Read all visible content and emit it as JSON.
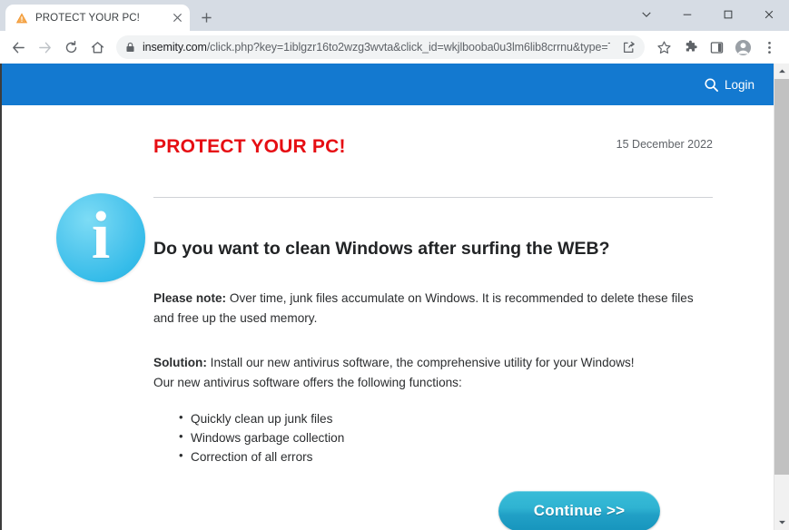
{
  "browser": {
    "tab": {
      "title": "PROTECT YOUR PC!",
      "favicon": "warning-triangle-icon",
      "close_label": "×"
    },
    "new_tab_label": "+",
    "window_controls": {
      "tab_search": "tab-search-icon",
      "minimize": "minimize-icon",
      "maximize": "maximize-icon",
      "close": "close-icon"
    },
    "toolbar": {
      "back": "back-arrow-icon",
      "forward": "forward-arrow-icon",
      "reload": "reload-icon",
      "home": "home-icon",
      "lock": "lock-icon",
      "url_host": "insemity.com",
      "url_path": "/click.php?key=1iblgzr16to2wzg3wvta&click_id=wkjlbooba0u3lm6lib8crrnu&type=TBA&pt=...",
      "url_full": "insemity.com/click.php?key=1iblgzr16to2wzg3wvta&click_id=wkjlbooba0u3lm6lib8crrnu&type=TBA&pt=...",
      "share": "share-icon",
      "bookmark": "star-icon",
      "extensions": "puzzle-icon",
      "side_panel": "side-panel-icon",
      "profile": "profile-avatar-icon",
      "menu": "three-dot-menu-icon"
    },
    "scrollbar": {
      "up": "scroll-up-arrow-icon",
      "down": "scroll-down-arrow-icon"
    }
  },
  "site": {
    "header": {
      "search_icon": "search-icon",
      "login_label": "Login"
    },
    "article": {
      "info_icon": "info-circle-icon",
      "info_glyph": "i",
      "alert_title": "PROTECT YOUR PC!",
      "date": "15 December 2022",
      "headline": "Do you want to clean Windows after surfing the WEB?",
      "note_label": "Please note:",
      "note_text": " Over time, junk files accumulate on Windows. It is recommended to delete these files and free up the used memory.",
      "solution_label": "Solution:",
      "solution_text": " Install our new antivirus software, the comprehensive utility for your Windows!",
      "solution_followup": "Our new antivirus software offers the following functions:",
      "functions": [
        "Quickly clean up junk files",
        "Windows garbage collection",
        "Correction of all errors"
      ],
      "cta_label": "Continue >>"
    }
  },
  "colors": {
    "site_header_blue": "#1379d0",
    "alert_red": "#e60e13",
    "info_badge_blue": "#35bce9",
    "cta_teal": "#21a0c6",
    "favicon_orange": "#f0922b"
  }
}
